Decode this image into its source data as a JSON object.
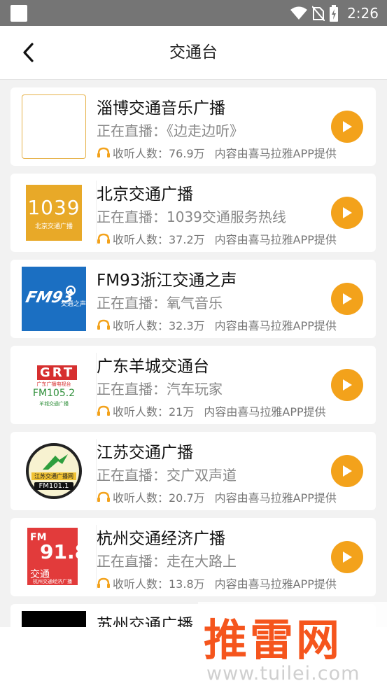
{
  "status": {
    "time": "2:26"
  },
  "header": {
    "title": "交通台"
  },
  "stations": [
    {
      "name": "淄博交通音乐广播",
      "live": "正在直播：《边走边听》",
      "listeners": "收听人数：76.9万",
      "source": "内容由喜马拉雅APP提供",
      "logo_style": "blank"
    },
    {
      "name": "北京交通广播",
      "live": "正在直播：1039交通服务热线",
      "listeners": "收听人数：37.2万",
      "source": "内容由喜马拉雅APP提供",
      "logo_style": "bj",
      "logo_text": "1039",
      "logo_sub": "北京交通广播"
    },
    {
      "name": "FM93浙江交通之声",
      "live": "正在直播：氧气音乐",
      "listeners": "收听人数：32.3万",
      "source": "内容由喜马拉雅APP提供",
      "logo_style": "zj",
      "logo_text": "FM93",
      "logo_sub": "交通之声"
    },
    {
      "name": "广东羊城交通台",
      "live": "正在直播：汽车玩家",
      "listeners": "收听人数：21万",
      "source": "内容由喜马拉雅APP提供",
      "logo_style": "gd",
      "logo_text": "GRT",
      "logo_sub": "广东广播电视台",
      "logo_freq": "FM105.2",
      "logo_sub2": "羊城交通广播"
    },
    {
      "name": "江苏交通广播",
      "live": "正在直播：交广双声道",
      "listeners": "收听人数：20.7万",
      "source": "内容由喜马拉雅APP提供",
      "logo_style": "js",
      "logo_text": "江苏交通广播网",
      "logo_freq": "FM101.1"
    },
    {
      "name": "杭州交通经济广播",
      "live": "正在直播：走在大路上",
      "listeners": "收听人数：13.8万",
      "source": "内容由喜马拉雅APP提供",
      "logo_style": "hz",
      "logo_text": "FM",
      "logo_freq": "91.8",
      "logo_sub": "交通",
      "logo_sub2": "杭州交通经济广播"
    },
    {
      "name": "苏州交通广播",
      "live": "",
      "listeners": "",
      "source": "",
      "logo_style": "sz"
    }
  ],
  "watermark": {
    "main": "推雷网",
    "url": "www.tuilei.com"
  },
  "colors": {
    "accent": "#f3a21b",
    "status_bar": "#757575"
  }
}
